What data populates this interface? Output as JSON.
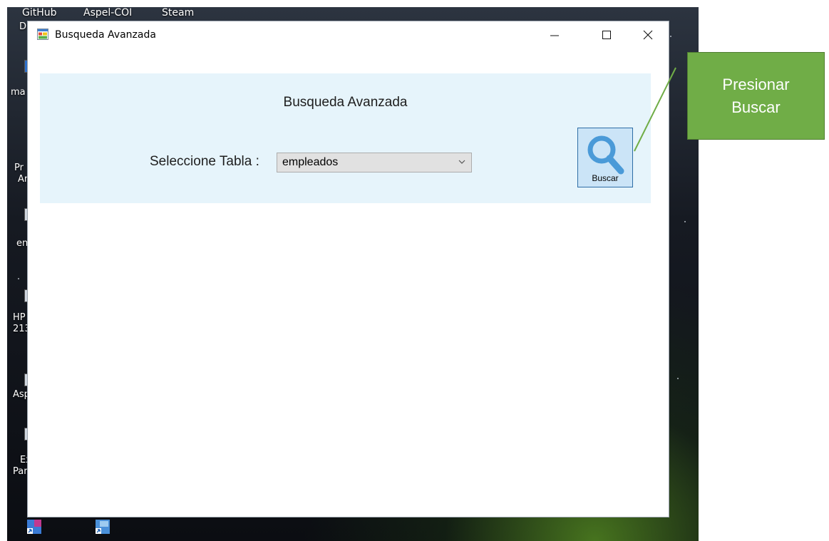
{
  "desktop": {
    "top_shortcuts": [
      "GitHub",
      "Aspel-COI",
      "Steam"
    ],
    "left_labels": [
      "D",
      "ma",
      "Pr",
      "Ar",
      "en",
      "HP",
      "213",
      "Asp",
      "Ex",
      "Par"
    ]
  },
  "window": {
    "title": "Busqueda Avanzada",
    "icon": "form-icon",
    "controls": {
      "minimize": "minimize-icon",
      "maximize": "maximize-icon",
      "close": "close-icon"
    }
  },
  "form": {
    "heading": "Busqueda Avanzada",
    "table_label": "Seleccione Tabla :",
    "table_select": {
      "value": "empleados"
    },
    "search_button": {
      "label": "Buscar",
      "icon": "search-icon"
    }
  },
  "callout": {
    "line1": "Presionar",
    "line2": "Buscar"
  },
  "colors": {
    "panel_background": "#e6f4fb",
    "search_button_fill": "#cbe4f7",
    "callout_fill": "#70ad47"
  }
}
